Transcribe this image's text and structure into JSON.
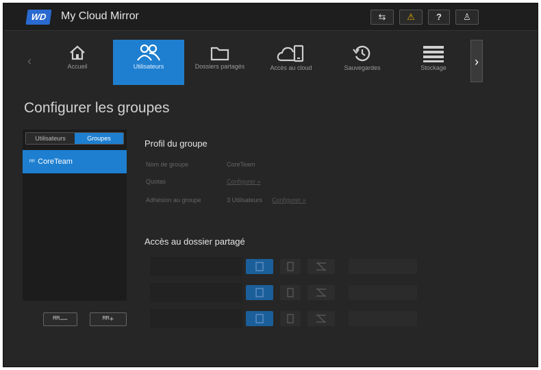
{
  "app": {
    "logo": "WD",
    "title": "My Cloud Mirror"
  },
  "top_actions": {
    "usb": "usb-icon",
    "alert": "bell-icon",
    "help": "?",
    "user": "user-icon"
  },
  "nav": {
    "items": [
      {
        "label": "Accueil",
        "icon": "home-icon"
      },
      {
        "label": "Utilisateurs",
        "icon": "users-icon",
        "active": true
      },
      {
        "label": "Dossiers partagés",
        "icon": "folder-icon"
      },
      {
        "label": "Accès au cloud",
        "icon": "cloud-device-icon"
      },
      {
        "label": "Sauvegardes",
        "icon": "history-icon"
      },
      {
        "label": "Stockage",
        "icon": "storage-icon"
      }
    ],
    "prev": "‹",
    "next": "›"
  },
  "page_title": "Configurer les groupes",
  "tabs": {
    "users": "Utilisateurs",
    "groups": "Groupes"
  },
  "groups": [
    {
      "name": "CoreTeam"
    }
  ],
  "side_buttons": {
    "remove": "ᴿᴿ—",
    "add": "ᴿᴿ+"
  },
  "profile": {
    "title": "Profil du groupe",
    "name_label": "Nom de groupe",
    "name_value": "CoreTeam",
    "quota_label": "Quotas",
    "quota_link": "Configurer »",
    "membership_label": "Adhésion au groupe",
    "membership_value": "3 Utilisateurs",
    "membership_link": "Configurer »"
  },
  "access": {
    "title": "Accès au dossier partagé"
  },
  "colors": {
    "accent": "#1e7fd0",
    "background": "#262626"
  }
}
